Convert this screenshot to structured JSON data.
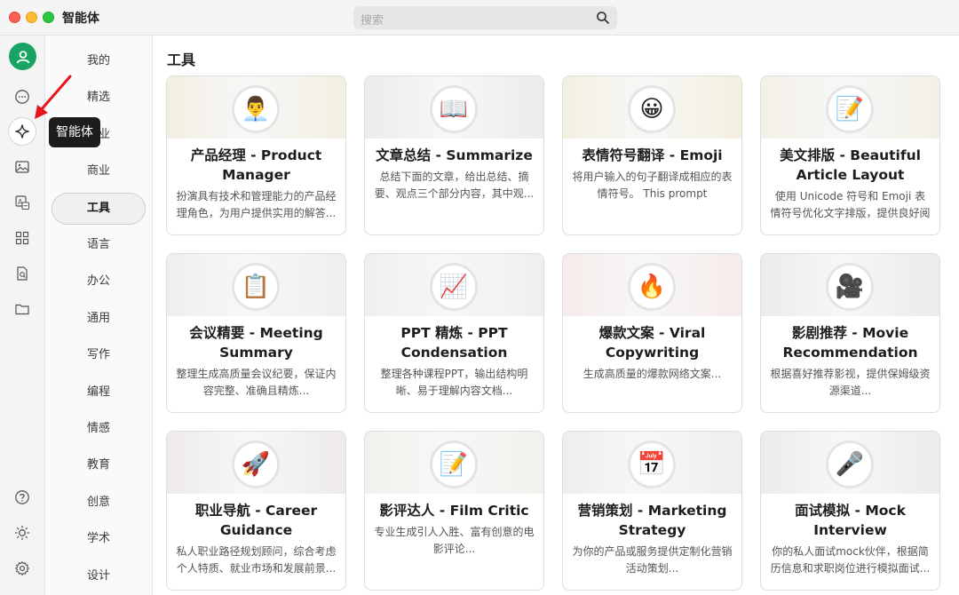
{
  "window": {
    "title": "智能体"
  },
  "search": {
    "placeholder": "搜索"
  },
  "tooltip": {
    "text": "智能体"
  },
  "rail": {
    "icons": [
      "user-avatar-icon",
      "chat-icon",
      "sparkle-icon",
      "image-icon",
      "translate-icon",
      "apps-grid-icon",
      "doc-search-icon",
      "folder-icon",
      "help-icon",
      "theme-sun-icon",
      "settings-gear-icon"
    ]
  },
  "categories": [
    "我的",
    "精选",
    "职业",
    "商业",
    "工具",
    "语言",
    "办公",
    "通用",
    "写作",
    "编程",
    "情感",
    "教育",
    "创意",
    "学术",
    "设计"
  ],
  "active_category": "工具",
  "section": {
    "title": "工具"
  },
  "cards": [
    {
      "emoji": "👨‍💼",
      "title": "产品经理 - Product Manager",
      "desc": "扮演具有技术和管理能力的产品经理角色，为用户提供实用的解答...",
      "two_line": true,
      "tint": "#f3efe2"
    },
    {
      "emoji": "📖",
      "title": "文章总结 - Summarize",
      "desc": "总结下面的文章，给出总结、摘要、观点三个部分内容，其中观...",
      "two_line": false,
      "tint": "#ececec"
    },
    {
      "emoji": "😀",
      "title": "表情符号翻译 - Emoji",
      "desc": "将用户输入的句子翻译成相应的表情符号。 This prompt translate...",
      "two_line": false,
      "tint": "#f4f0e0"
    },
    {
      "emoji": "📝",
      "title": "美文排版 - Beautiful Article Layout",
      "desc": "使用 Unicode 符号和 Emoji 表情符号优化文字排版，提供良好阅读...",
      "two_line": true,
      "tint": "#f3f0e6"
    },
    {
      "emoji": "📋",
      "title": "会议精要 - Meeting Summary",
      "desc": "整理生成高质量会议纪要，保证内容完整、准确且精炼...",
      "two_line": true,
      "tint": "#efefef"
    },
    {
      "emoji": "📈",
      "title": "PPT 精炼 - PPT Condensation",
      "desc": "整理各种课程PPT，输出结构明晰、易于理解内容文档...",
      "two_line": true,
      "tint": "#f1eeee"
    },
    {
      "emoji": "🔥",
      "title": "爆款文案 - Viral Copywriting",
      "desc": "生成高质量的爆款网络文案...",
      "two_line": true,
      "tint": "#f6ecea"
    },
    {
      "emoji": "🎥",
      "title": "影剧推荐 - Movie Recommendation",
      "desc": "根据喜好推荐影视，提供保姆级资源渠道...",
      "two_line": true,
      "tint": "#ebebeb"
    },
    {
      "emoji": "🚀",
      "title": "职业导航 - Career Guidance",
      "desc": "私人职业路径规划顾问，综合考虑个人特质、就业市场和发展前景...",
      "two_line": true,
      "tint": "#eeeaea"
    },
    {
      "emoji": "📝",
      "title": "影评达人 - Film Critic",
      "desc": "专业生成引人入胜、富有创意的电影评论...",
      "two_line": false,
      "tint": "#f2f1ec"
    },
    {
      "emoji": "📅",
      "title": "营销策划 - Marketing Strategy",
      "desc": "为你的产品或服务提供定制化营销活动策划...",
      "two_line": true,
      "tint": "#eeeeee"
    },
    {
      "emoji": "🎤",
      "title": "面试模拟 - Mock Interview",
      "desc": "你的私人面试mock伙伴，根据简历信息和求职岗位进行模拟面试...",
      "two_line": true,
      "tint": "#ececec"
    }
  ]
}
